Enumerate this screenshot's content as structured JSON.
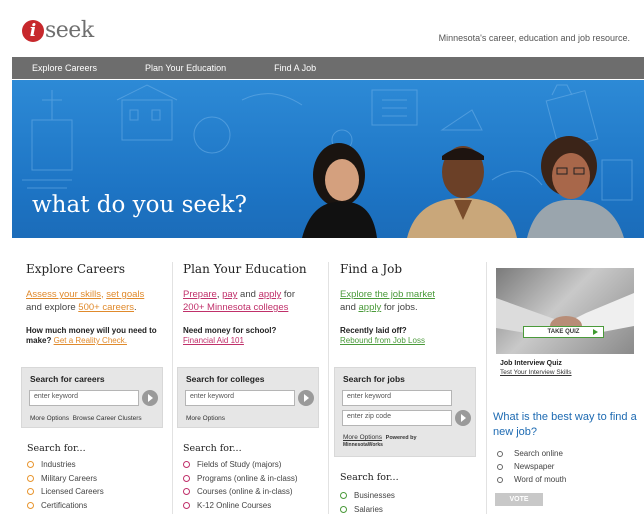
{
  "header": {
    "logo_letter": "i",
    "logo_word": "seek",
    "tagline": "Minnesota's career, education and job resource."
  },
  "nav": [
    "Explore Careers",
    "Plan Your Education",
    "Find A Job"
  ],
  "hero": {
    "headline": "what do you seek?"
  },
  "explore": {
    "title": "Explore Careers",
    "link1": "Assess your skills",
    "sep": ", ",
    "link2": "set goals",
    "text1": "and explore ",
    "link3": "500+ careers",
    "text2": ".",
    "question": "How much money will you need to make?",
    "q_link": "Get a Reality Check.",
    "search_title": "Search for careers",
    "placeholder": "enter keyword",
    "more": "More Options",
    "browse": "Browse Career Clusters",
    "search_for": "Search for...",
    "items": [
      "Industries",
      "Military Careers",
      "Licensed Careers",
      "Certifications"
    ]
  },
  "plan": {
    "title": "Plan Your Education",
    "link1": "Prepare",
    "sep": ", ",
    "link2": "pay",
    "text1": " and ",
    "link3": "apply",
    "text2": " for",
    "link4": "200+ Minnesota colleges",
    "question": "Need money for school?",
    "q_link": "Financial Aid 101",
    "search_title": "Search for colleges",
    "placeholder": "enter keyword",
    "more": "More Options",
    "search_for": "Search for...",
    "items": [
      "Fields of Study (majors)",
      "Programs (online & in-class)",
      "Courses (online & in-class)",
      "K-12 Online Courses"
    ]
  },
  "job": {
    "title": "Find a Job",
    "link1": "Explore the job market",
    "text1": "and ",
    "link2": "apply",
    "text2": " for jobs.",
    "question": "Recently laid off?",
    "q_link": "Rebound from Job Loss",
    "search_title": "Search for jobs",
    "placeholder": "enter keyword",
    "zip_placeholder": "enter zip code",
    "more": "More Options",
    "powered": "Powered by",
    "powered_by": "MinnesotaWorks",
    "search_for": "Search for...",
    "items": [
      "Businesses",
      "Salaries"
    ]
  },
  "sidebar": {
    "take_quiz": "TAKE QUIZ",
    "quiz_title": "Job Interview Quiz",
    "quiz_sub": "Test Your Interview Skills",
    "poll_question": "What is the best way to find a new job?",
    "poll_options": [
      "Search online",
      "Newspaper",
      "Word of mouth"
    ],
    "vote": "VOTE"
  },
  "colors": {
    "brand_red": "#c7282c",
    "nav_gray": "#6d6d6d",
    "hero_blue": "#1d74c4",
    "orange": "#e08a2c",
    "pink": "#c0306a",
    "green": "#4a9a3a",
    "poll_blue": "#1d6ab2"
  }
}
